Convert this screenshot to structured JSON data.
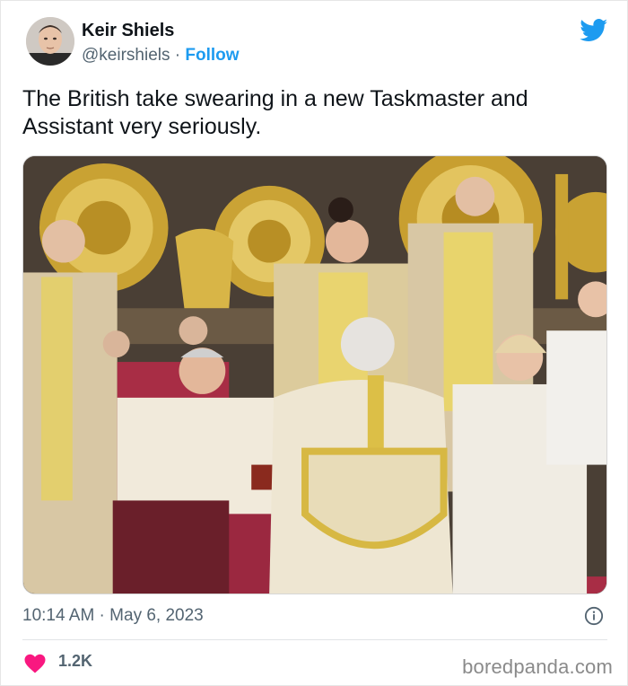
{
  "tweet": {
    "author_name": "Keir Shiels",
    "handle": "@keirshiels",
    "separator": " · ",
    "follow_label": "Follow",
    "text": "The British take swearing in a new Taskmaster and Assistant very seriously.",
    "time": "10:14 AM",
    "date": "May 6, 2023",
    "likes": "1.2K"
  },
  "footer": {
    "source": "boredpanda.com"
  },
  "colors": {
    "twitter_blue": "#1d9bf0",
    "heart": "#f91880",
    "muted_text": "#536471"
  },
  "icons": [
    "twitter-bird-icon",
    "info-icon",
    "heart-icon"
  ]
}
